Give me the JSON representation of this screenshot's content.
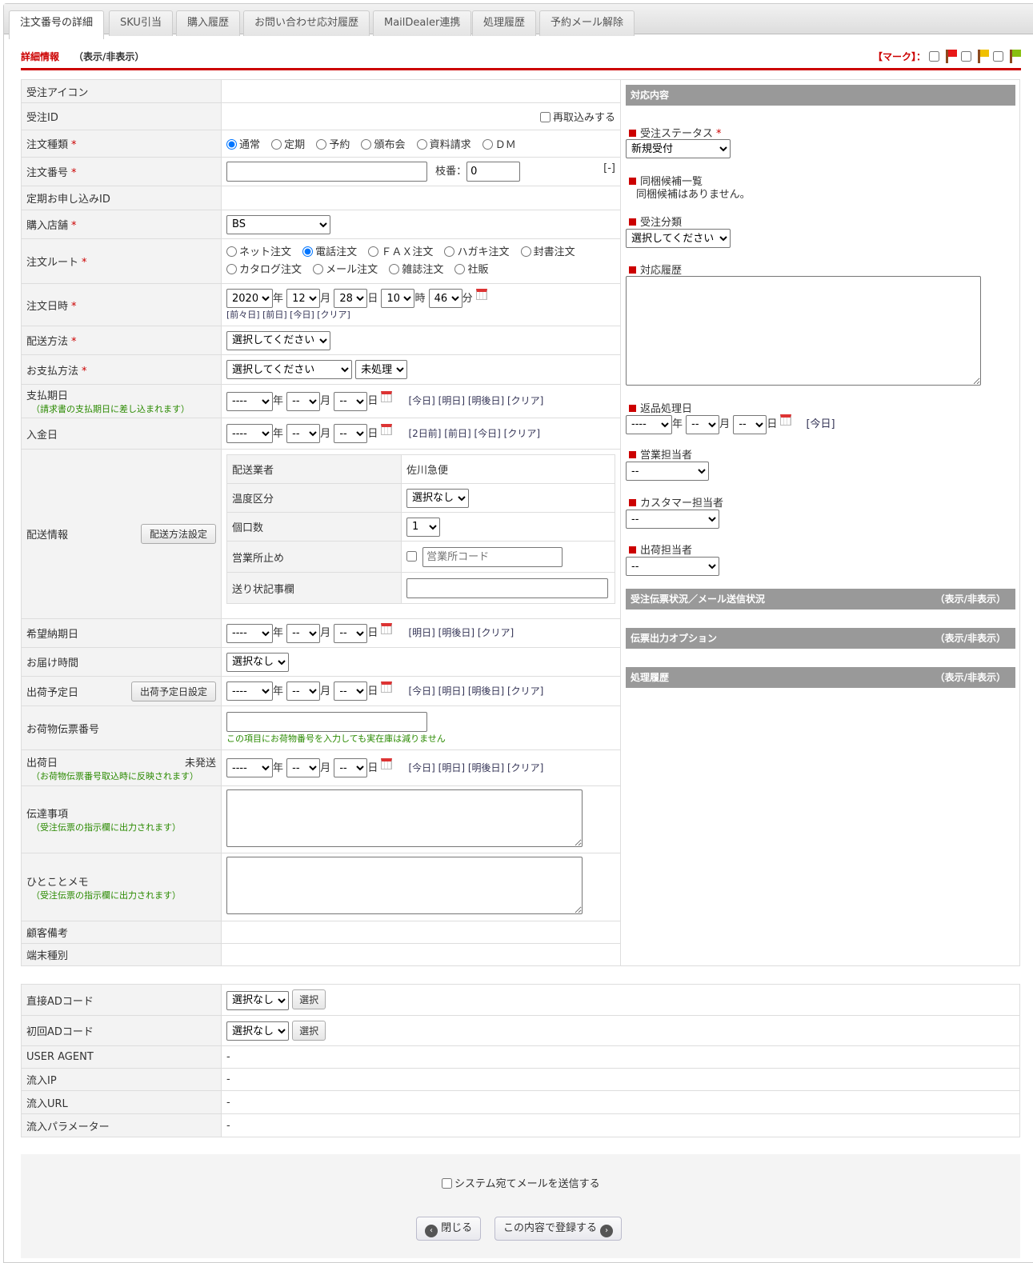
{
  "tabs": [
    "注文番号の詳細",
    "SKU引当",
    "購入履歴",
    "お問い合わせ応対履歴",
    "MailDealer連携",
    "処理履歴",
    "予約メール解除"
  ],
  "section": {
    "title": "詳細情報",
    "toggle": "（表示/非表示）"
  },
  "mark": {
    "label": "【マーク】：",
    "colors": [
      "#e81818",
      "#f0c000",
      "#88c010"
    ]
  },
  "req": "*",
  "rows": {
    "icon": "受注アイコン",
    "id": "受注ID",
    "reimport": "再取込みする",
    "type": "注文種類",
    "type_opts": [
      "通常",
      "定期",
      "予約",
      "頒布会",
      "資料請求",
      "ＤＭ"
    ],
    "number": "注文番号",
    "branch": "枝番：",
    "branch_val": "0",
    "collapse": "[-]",
    "sub_id": "定期お申し込みID",
    "store": "購入店舗",
    "store_val": "BS",
    "route": "注文ルート",
    "route_opts": [
      "ネット注文",
      "電話注文",
      "ＦＡＸ注文",
      "ハガキ注文",
      "封書注文",
      "カタログ注文",
      "メール注文",
      "雑誌注文",
      "社販"
    ],
    "datetime": "注文日時",
    "dt": {
      "year": "2020",
      "month": "12",
      "day": "28",
      "hour": "10",
      "min": "46"
    },
    "u": {
      "y": "年",
      "m": "月",
      "d": "日",
      "h": "時",
      "mi": "分"
    },
    "dt_links": "[前々日] [前日] [今日] [クリア]",
    "ship": "配送方法",
    "choose": "選択してください",
    "pay": "お支払方法",
    "pay_status": "未処理",
    "due": "支払期日",
    "due_note": "（請求書の支払期日に差し込まれます）",
    "due_links": "[今日] [明日] [明後日] [クリア]",
    "paid": "入金日",
    "paid_links": "[2日前] [前日] [今日] [クリア]",
    "empty_y": "----",
    "empty": "--",
    "delivery": "配送情報",
    "delivery_btn": "配送方法設定",
    "carrier": "配送業者",
    "carrier_val": "佐川急便",
    "temp": "温度区分",
    "none": "選択なし",
    "pieces": "個口数",
    "pieces_val": "1",
    "office": "営業所止め",
    "office_ph": "営業所コード",
    "slip_note": "送り状記事欄",
    "wish": "希望納期日",
    "wish_links": "[明日] [明後日] [クリア]",
    "time": "お届け時間",
    "plan": "出荷予定日",
    "plan_btn": "出荷予定日設定",
    "plan_links": "[今日] [明日] [明後日] [クリア]",
    "tracking": "お荷物伝票番号",
    "tracking_note": "この項目にお荷物番号を入力しても実在庫は減りません",
    "shipped": "出荷日",
    "shipped_status": "未発送",
    "shipped_note": "（お荷物伝票番号取込時に反映されます）",
    "shipped_links": "[今日] [明日] [明後日] [クリア]",
    "message": "伝達事項",
    "message_note": "（受注伝票の指示欄に出力されます）",
    "memo": "ひとことメモ",
    "memo_note": "（受注伝票の指示欄に出力されます）",
    "cust_note": "顧客備考",
    "device": "端末種別"
  },
  "right": {
    "head": "対応内容",
    "status": "受注ステータス",
    "status_val": "新規受付",
    "bundle": "同梱候補一覧",
    "bundle_text": "同梱候補はありません。",
    "category": "受注分類",
    "history": "対応履歴",
    "return": "返品処理日",
    "return_link": "[今日]",
    "sales": "営業担当者",
    "customer": "カスタマー担当者",
    "shipper": "出荷担当者",
    "bars": [
      "受注伝票状況／メール送信状況",
      "伝票出力オプション",
      "処理履歴"
    ],
    "toggle": "（表示/非表示）"
  },
  "bottom": {
    "direct_ad": "直接ADコード",
    "first_ad": "初回ADコード",
    "select": "選択",
    "ua": "USER AGENT",
    "ip": "流入IP",
    "url": "流入URL",
    "param": "流入パラメーター",
    "dash": "-"
  },
  "footer": {
    "mail": "システム宛てメールを送信する",
    "close": "閉じる",
    "submit": "この内容で登録する"
  }
}
